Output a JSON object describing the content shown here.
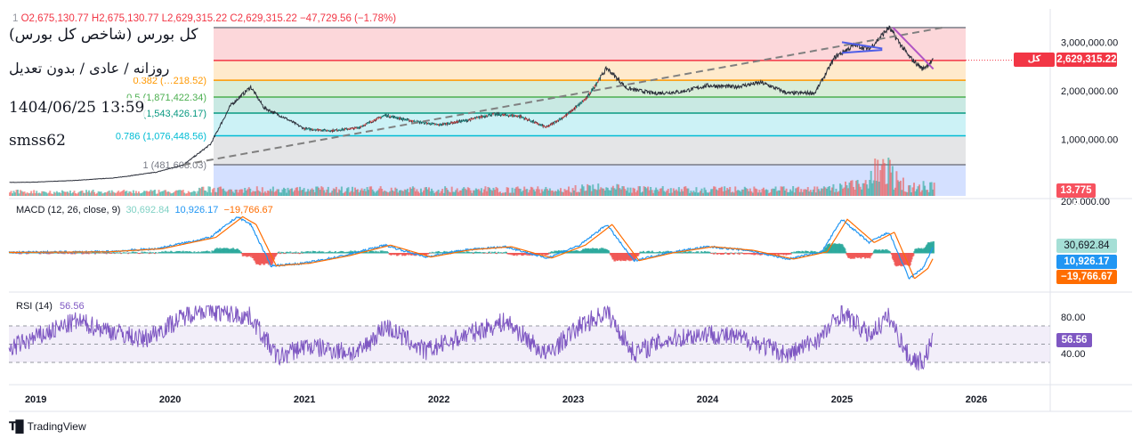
{
  "header": {
    "ohlc_prefix": "1",
    "open": "O2,675,130.77",
    "high": "H2,675,130.77",
    "low": "L2,629,315.22",
    "close": "C2,629,315.22",
    "change": "−47,729.56 (−1.78%)"
  },
  "overlay": {
    "title": "کل بورس (شاخص کل بورس)",
    "subtitle": "روزانه / عادی / بدون تعدیل",
    "datetime": "1404/06/25 13:59",
    "username": "smss62"
  },
  "macd_legend": {
    "label": "MACD (12, 26, close, 9)",
    "v1": "30,692.84",
    "v2": "10,926.17",
    "v3": "−19,766.67"
  },
  "rsi_legend": {
    "label": "RSI (14)",
    "value": "56.56"
  },
  "price_tag": {
    "name": "کل بورس",
    "value": "2,629,315.22"
  },
  "volume_tag": "13.775 B",
  "macd_tags": [
    "30,692.84",
    "10,926.17",
    "−19,766.67"
  ],
  "rsi_tag": "56.56",
  "footer": {
    "brand": "TradingView"
  },
  "colors": {
    "up": "#26a69a",
    "down": "#ef5350",
    "macd": "#2196f3",
    "signal": "#ff6d00",
    "rsi": "#7e57c2"
  },
  "chart_data": {
    "type": "line",
    "price_axis": {
      "ticks": [
        1000000,
        2000000,
        3000000
      ],
      "labels": [
        "1,000,000.00",
        "2,000,000.00",
        "3,000,000.00"
      ]
    },
    "volume_axis_label": "200,000.00",
    "x_ticks": [
      {
        "label": "2019",
        "t": 2019.0
      },
      {
        "label": "2020",
        "t": 2020.0
      },
      {
        "label": "2021",
        "t": 2021.0
      },
      {
        "label": "2022",
        "t": 2022.0
      },
      {
        "label": "2023",
        "t": 2023.0
      },
      {
        "label": "2024",
        "t": 2024.0
      },
      {
        "label": "2025",
        "t": 2025.0
      },
      {
        "label": "2026",
        "t": 2026.0
      }
    ],
    "fib_levels": [
      {
        "ratio": "0",
        "value": 3300000,
        "label": "",
        "color": "#787b86"
      },
      {
        "ratio": "0.236",
        "value": 2626000,
        "label": "",
        "color": "#f23645"
      },
      {
        "ratio": "0.382",
        "value": 2218000,
        "label": "0.382 (…218.52)",
        "color": "#ff9800"
      },
      {
        "ratio": "0.5",
        "value": 1871422.34,
        "label": "0.5 (1,871,422.34)",
        "color": "#4caf50"
      },
      {
        "ratio": "0.618",
        "value": 1543426.17,
        "label": "(1,543,426.17)",
        "color": "#089981"
      },
      {
        "ratio": "0.786",
        "value": 1076448.56,
        "label": "0.786 (1,076,448.56)",
        "color": "#00bcd4"
      },
      {
        "ratio": "1",
        "value": 481608.03,
        "label": "1 (481,608.03)",
        "color": "#787b86"
      }
    ],
    "price_series": [
      [
        2018.0,
        95000
      ],
      [
        2018.5,
        105000
      ],
      [
        2019.0,
        125000
      ],
      [
        2019.3,
        160000
      ],
      [
        2019.6,
        215000
      ],
      [
        2019.9,
        330000
      ],
      [
        2020.1,
        481608
      ],
      [
        2020.3,
        900000
      ],
      [
        2020.45,
        1700000
      ],
      [
        2020.6,
        2080000
      ],
      [
        2020.7,
        1650000
      ],
      [
        2020.85,
        1450000
      ],
      [
        2021.0,
        1220000
      ],
      [
        2021.2,
        1180000
      ],
      [
        2021.4,
        1240000
      ],
      [
        2021.6,
        1500000
      ],
      [
        2021.8,
        1380000
      ],
      [
        2022.0,
        1300000
      ],
      [
        2022.2,
        1390000
      ],
      [
        2022.4,
        1520000
      ],
      [
        2022.6,
        1480000
      ],
      [
        2022.8,
        1250000
      ],
      [
        2022.95,
        1500000
      ],
      [
        2023.1,
        1850000
      ],
      [
        2023.25,
        2470000
      ],
      [
        2023.4,
        2050000
      ],
      [
        2023.6,
        1950000
      ],
      [
        2023.8,
        1980000
      ],
      [
        2024.0,
        2110000
      ],
      [
        2024.2,
        2080000
      ],
      [
        2024.4,
        2170000
      ],
      [
        2024.6,
        1950000
      ],
      [
        2024.8,
        1960000
      ],
      [
        2024.95,
        2700000
      ],
      [
        2025.1,
        2950000
      ],
      [
        2025.2,
        2850000
      ],
      [
        2025.35,
        3300000
      ],
      [
        2025.5,
        2700000
      ],
      [
        2025.6,
        2450000
      ],
      [
        2025.68,
        2629315
      ]
    ],
    "trendlines": [
      {
        "name": "",
        "from": [
          2020.1,
          481608
        ],
        "to": [
          2025.75,
          3300000
        ],
        "color": "#808080",
        "dashed": true
      },
      {
        "name": "",
        "from": [
          2025.0,
          3000000
        ],
        "to": [
          2025.3,
          2870000
        ],
        "color": "#4f5ee8",
        "dashed": false
      },
      {
        "name": "",
        "from": [
          2025.0,
          2780000
        ],
        "to": [
          2025.3,
          2840000
        ],
        "color": "#4f5ee8",
        "dashed": false
      },
      {
        "name": "",
        "from": [
          2025.38,
          3300000
        ],
        "to": [
          2025.68,
          2450000
        ],
        "color": "#b154c4",
        "dashed": false
      }
    ],
    "macd": [
      [
        2018.0,
        0
      ],
      [
        2019.5,
        2000
      ],
      [
        2019.9,
        8000
      ],
      [
        2020.3,
        30000
      ],
      [
        2020.5,
        70000
      ],
      [
        2020.6,
        55000
      ],
      [
        2020.75,
        -25000
      ],
      [
        2021.0,
        -20000
      ],
      [
        2021.3,
        -5000
      ],
      [
        2021.6,
        15000
      ],
      [
        2021.9,
        -8000
      ],
      [
        2022.2,
        6000
      ],
      [
        2022.5,
        12000
      ],
      [
        2022.8,
        -10000
      ],
      [
        2023.05,
        15000
      ],
      [
        2023.25,
        55000
      ],
      [
        2023.45,
        -15000
      ],
      [
        2023.7,
        0
      ],
      [
        2024.0,
        12000
      ],
      [
        2024.3,
        5000
      ],
      [
        2024.6,
        -12000
      ],
      [
        2024.85,
        2000
      ],
      [
        2025.0,
        65000
      ],
      [
        2025.2,
        20000
      ],
      [
        2025.35,
        40000
      ],
      [
        2025.5,
        -50000
      ],
      [
        2025.6,
        -30000
      ],
      [
        2025.68,
        10926
      ]
    ],
    "rsi": [
      [
        2018.0,
        58
      ],
      [
        2018.4,
        72
      ],
      [
        2018.8,
        45
      ],
      [
        2019.3,
        75
      ],
      [
        2019.8,
        55
      ],
      [
        2020.2,
        88
      ],
      [
        2020.6,
        80
      ],
      [
        2020.8,
        35
      ],
      [
        2021.0,
        48
      ],
      [
        2021.4,
        40
      ],
      [
        2021.6,
        70
      ],
      [
        2021.9,
        42
      ],
      [
        2022.2,
        60
      ],
      [
        2022.5,
        75
      ],
      [
        2022.8,
        38
      ],
      [
        2023.05,
        70
      ],
      [
        2023.25,
        85
      ],
      [
        2023.45,
        40
      ],
      [
        2023.7,
        55
      ],
      [
        2024.0,
        62
      ],
      [
        2024.3,
        55
      ],
      [
        2024.6,
        38
      ],
      [
        2024.85,
        58
      ],
      [
        2025.0,
        85
      ],
      [
        2025.2,
        60
      ],
      [
        2025.35,
        80
      ],
      [
        2025.5,
        35
      ],
      [
        2025.6,
        30
      ],
      [
        2025.68,
        56.56
      ]
    ],
    "rsi_axis": {
      "labels": [
        "80.00",
        "40.00"
      ],
      "band": [
        30,
        70
      ],
      "mid": 50
    }
  }
}
